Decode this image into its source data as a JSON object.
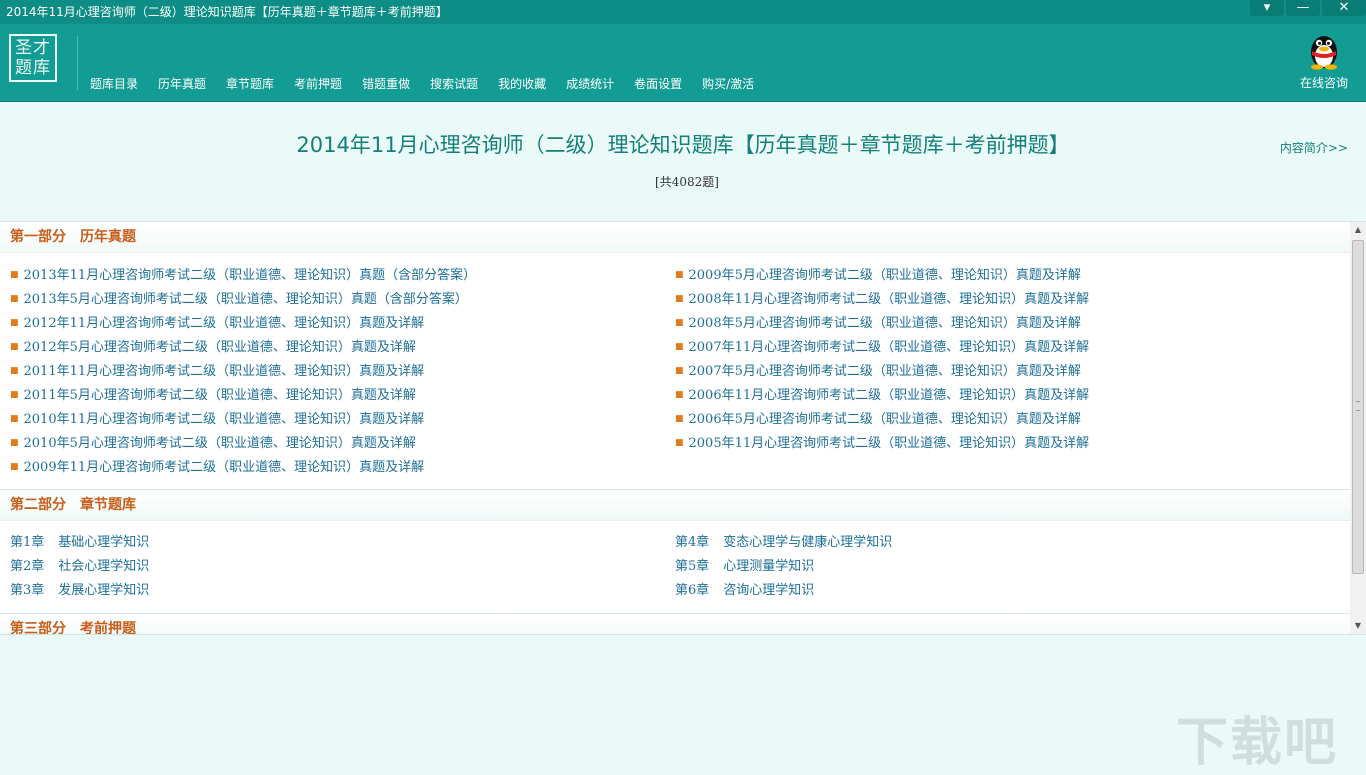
{
  "window": {
    "title": "2014年11月心理咨询师（二级）理论知识题库【历年真题＋章节题库＋考前押题】",
    "btn_menu": "▾",
    "btn_min": "—",
    "btn_close": "✕"
  },
  "toolbar": {
    "logo_line1": "圣才",
    "logo_line2": "题库",
    "nav": [
      "题库目录",
      "历年真题",
      "章节题库",
      "考前押题",
      "错题重做",
      "搜索试题",
      "我的收藏",
      "成绩统计",
      "卷面设置",
      "购买/激活"
    ],
    "consult_label": "在线咨询"
  },
  "header": {
    "book_title": "2014年11月心理咨询师（二级）理论知识题库【历年真题＋章节题库＋考前押题】",
    "count": "[共4082题]",
    "intro_link": "内容简介>>"
  },
  "sections": [
    {
      "num": "第一部分",
      "name": "历年真题",
      "left": [
        "2013年11月心理咨询师考试二级（职业道德、理论知识）真题（含部分答案）",
        "2013年5月心理咨询师考试二级（职业道德、理论知识）真题（含部分答案）",
        "2012年11月心理咨询师考试二级（职业道德、理论知识）真题及详解",
        "2012年5月心理咨询师考试二级（职业道德、理论知识）真题及详解",
        "2011年11月心理咨询师考试二级（职业道德、理论知识）真题及详解",
        "2011年5月心理咨询师考试二级（职业道德、理论知识）真题及详解",
        "2010年11月心理咨询师考试二级（职业道德、理论知识）真题及详解",
        "2010年5月心理咨询师考试二级（职业道德、理论知识）真题及详解",
        "2009年11月心理咨询师考试二级（职业道德、理论知识）真题及详解"
      ],
      "right": [
        "2009年5月心理咨询师考试二级（职业道德、理论知识）真题及详解",
        "2008年11月心理咨询师考试二级（职业道德、理论知识）真题及详解",
        "2008年5月心理咨询师考试二级（职业道德、理论知识）真题及详解",
        "2007年11月心理咨询师考试二级（职业道德、理论知识）真题及详解",
        "2007年5月心理咨询师考试二级（职业道德、理论知识）真题及详解",
        "2006年11月心理咨询师考试二级（职业道德、理论知识）真题及详解",
        "2006年5月心理咨询师考试二级（职业道德、理论知识）真题及详解",
        "2005年11月心理咨询师考试二级（职业道德、理论知识）真题及详解"
      ]
    },
    {
      "num": "第二部分",
      "name": "章节题库",
      "left": [
        {
          "num": "第1章",
          "name": "基础心理学知识"
        },
        {
          "num": "第2章",
          "name": "社会心理学知识"
        },
        {
          "num": "第3章",
          "name": "发展心理学知识"
        }
      ],
      "right": [
        {
          "num": "第4章",
          "name": "变态心理学与健康心理学知识"
        },
        {
          "num": "第5章",
          "name": "心理测量学知识"
        },
        {
          "num": "第6章",
          "name": "咨询心理学知识"
        }
      ]
    },
    {
      "num": "第三部分",
      "name": "考前押题"
    }
  ],
  "scrollbar": {
    "up": "▲",
    "down": "▼"
  },
  "watermark": "下载吧",
  "colors": {
    "toolbar": "#129c93",
    "titlebar": "#0e8d86",
    "section_head": "#c75e1a",
    "link": "#1e6f9a",
    "bullet": "#e07c1e"
  }
}
